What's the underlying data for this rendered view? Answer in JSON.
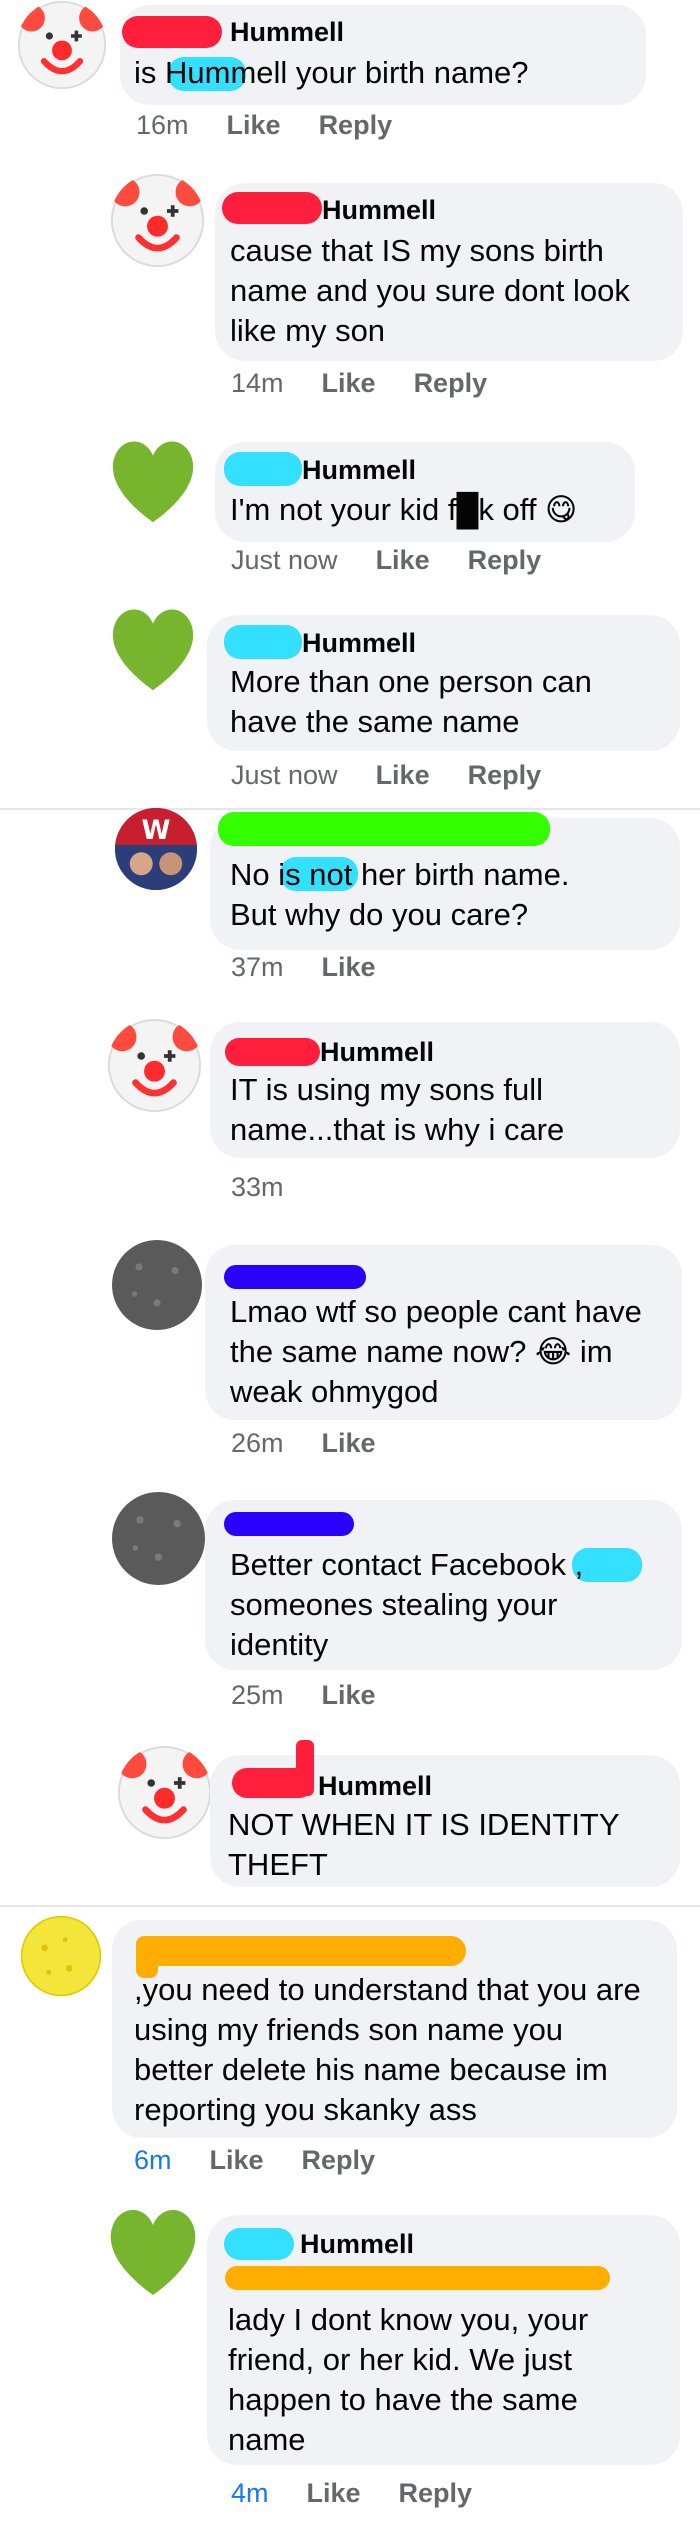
{
  "comments": [
    {
      "name": "Hummell",
      "lines": [
        "is          Hummell your birth name?"
      ],
      "time": "16m",
      "like": "Like",
      "reply": "Reply"
    },
    {
      "name": "Hummell",
      "lines": [
        "cause that IS my sons birth",
        "name and you sure dont look",
        "like my son"
      ],
      "time": "14m",
      "like": "Like",
      "reply": "Reply"
    },
    {
      "name": "Hummell",
      "lines": [
        "I'm not your kid f█k off 😋"
      ],
      "time": "Just now",
      "like": "Like",
      "reply": "Reply"
    },
    {
      "name": "Hummell",
      "lines": [
        "More than one person can",
        "have the same name"
      ],
      "time": "Just now",
      "like": "Like",
      "reply": "Reply"
    },
    {
      "name": "",
      "lines": [
        "No             is not her birth name.",
        "But why do you care?"
      ],
      "time": "37m",
      "like": "Like"
    },
    {
      "name": "Hummell",
      "lines": [
        "IT is using my sons full",
        "name...that is why i care"
      ],
      "time": "33m"
    },
    {
      "name": "",
      "lines": [
        "Lmao wtf so people cant have",
        "the same name now? 😂 im",
        "weak ohmygod"
      ],
      "time": "26m",
      "like": "Like"
    },
    {
      "name": "",
      "lines": [
        "Better contact Facebook          ,",
        "someones stealing your",
        "identity"
      ],
      "time": "25m",
      "like": "Like"
    },
    {
      "name": "Hummell",
      "lines": [
        "NOT WHEN IT IS IDENTITY",
        "THEFT"
      ]
    },
    {
      "name": "",
      "lines": [
        ",you need to understand that you are",
        "using my friends son name you",
        "better delete his name because im",
        "reporting you skanky ass"
      ],
      "time": "6m",
      "like": "Like",
      "reply": "Reply"
    },
    {
      "name": "Hummell",
      "lines": [
        "lady I dont know you, your",
        "friend, or her kid. We just",
        "happen to have the same",
        "name"
      ],
      "time": "4m",
      "like": "Like",
      "reply": "Reply"
    }
  ],
  "colors": {
    "bubble": "#f0f2f5",
    "meta_gray": "#65676b",
    "meta_blue": "#1877f2",
    "redact_red": "#ff1e3c",
    "redact_cyan": "#33e0ff",
    "redact_green": "#33ff00",
    "redact_blue": "#2a00ff",
    "redact_orange": "#ffae00"
  },
  "avatars": [
    "clown-avatar",
    "clown-avatar",
    "green-heart-avatar",
    "green-heart-avatar",
    "group-photo-avatar",
    "clown-avatar",
    "gray-avatar",
    "gray-avatar",
    "clown-avatar",
    "yellow-avatar",
    "green-heart-avatar"
  ]
}
